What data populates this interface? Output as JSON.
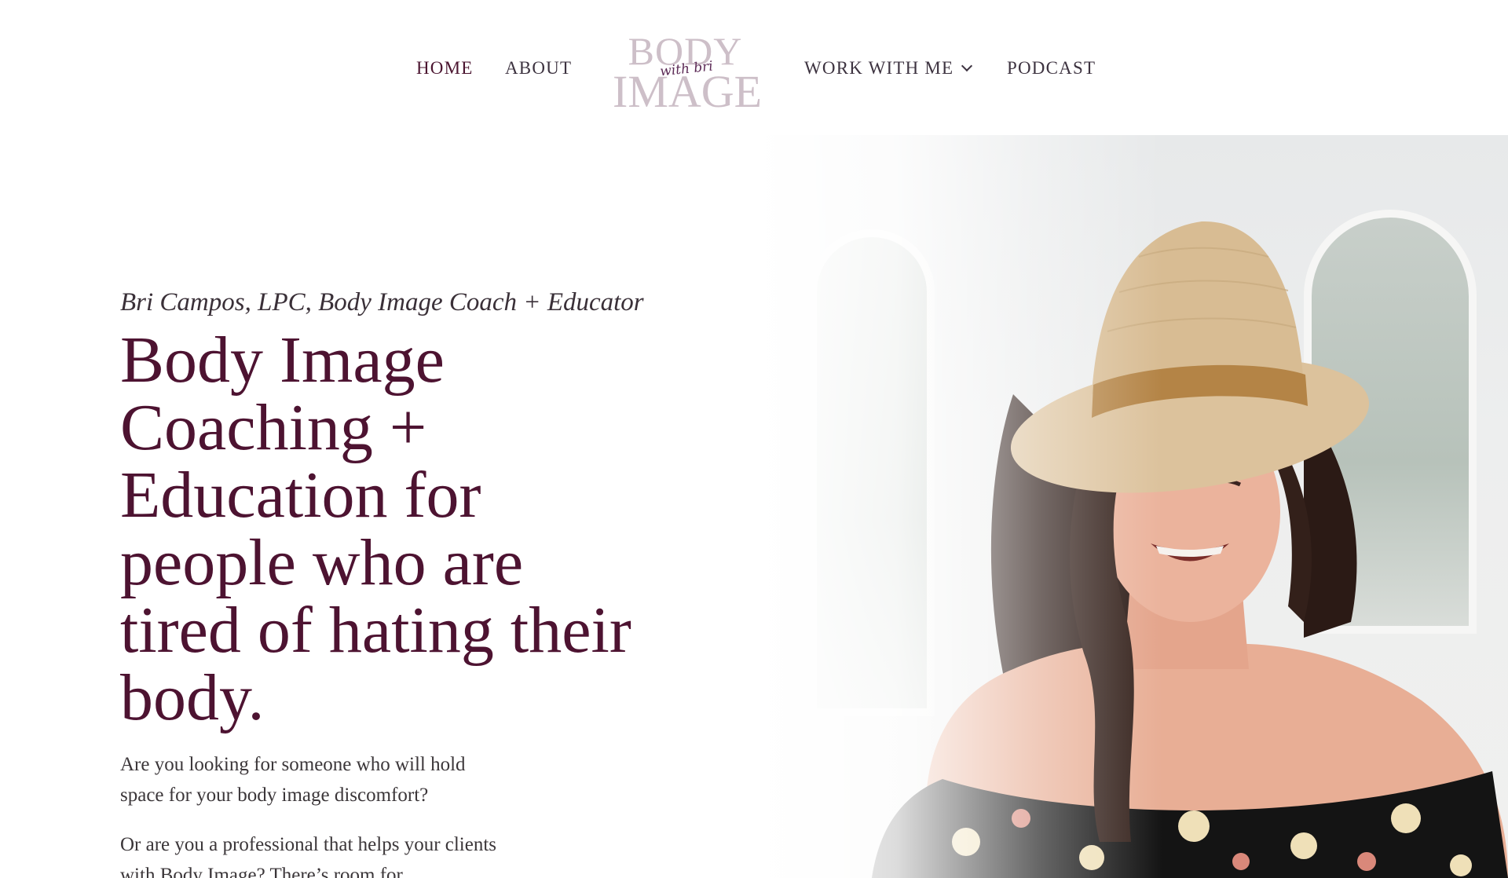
{
  "nav": {
    "home": "HOME",
    "about": "ABOUT",
    "work_with_me": "WORK WITH ME",
    "podcast": "PODCAST",
    "active": "home"
  },
  "logo": {
    "line1": "BODY",
    "script": "with bri",
    "line2": "IMAGE"
  },
  "hero": {
    "eyebrow": "Bri Campos, LPC, Body Image Coach + Educator",
    "headline": "Body Image Coaching + Education for people who are tired of hating their body.",
    "paragraph1": "Are you looking for someone who will hold space for your body image discomfort?",
    "paragraph2": "Or are you a professional that helps your clients with Body Image? There’s room for"
  },
  "colors": {
    "accent": "#4d1331",
    "logo": "#cdbfc8",
    "logo_script": "#5c2a56",
    "text": "#3b3639"
  },
  "icons": {
    "dropdown": "chevron-down-icon"
  }
}
